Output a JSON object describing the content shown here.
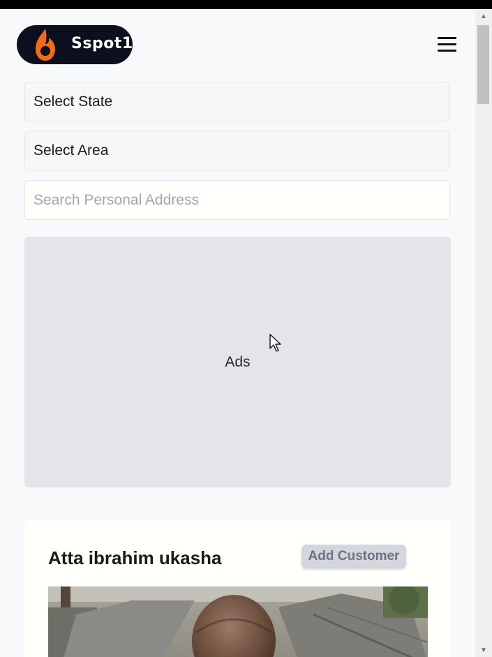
{
  "header": {
    "brand": "Sspot1",
    "logo_icon": "flame-logo-icon",
    "menu_icon": "hamburger-menu-icon",
    "brand_colors": {
      "badge": "#0c0f1d",
      "flame": "#f26a1b"
    }
  },
  "filters": {
    "state_select": "Select State",
    "area_select": "Select Area",
    "address_search_placeholder": "Search Personal Address"
  },
  "ads": {
    "label": "Ads"
  },
  "customer_card": {
    "name": "Atta ibrahim ukasha",
    "add_button_label": "Add Customer"
  },
  "scrollbar": {
    "up_icon": "scroll-up-arrow-icon",
    "down_icon": "scroll-down-arrow-icon"
  }
}
